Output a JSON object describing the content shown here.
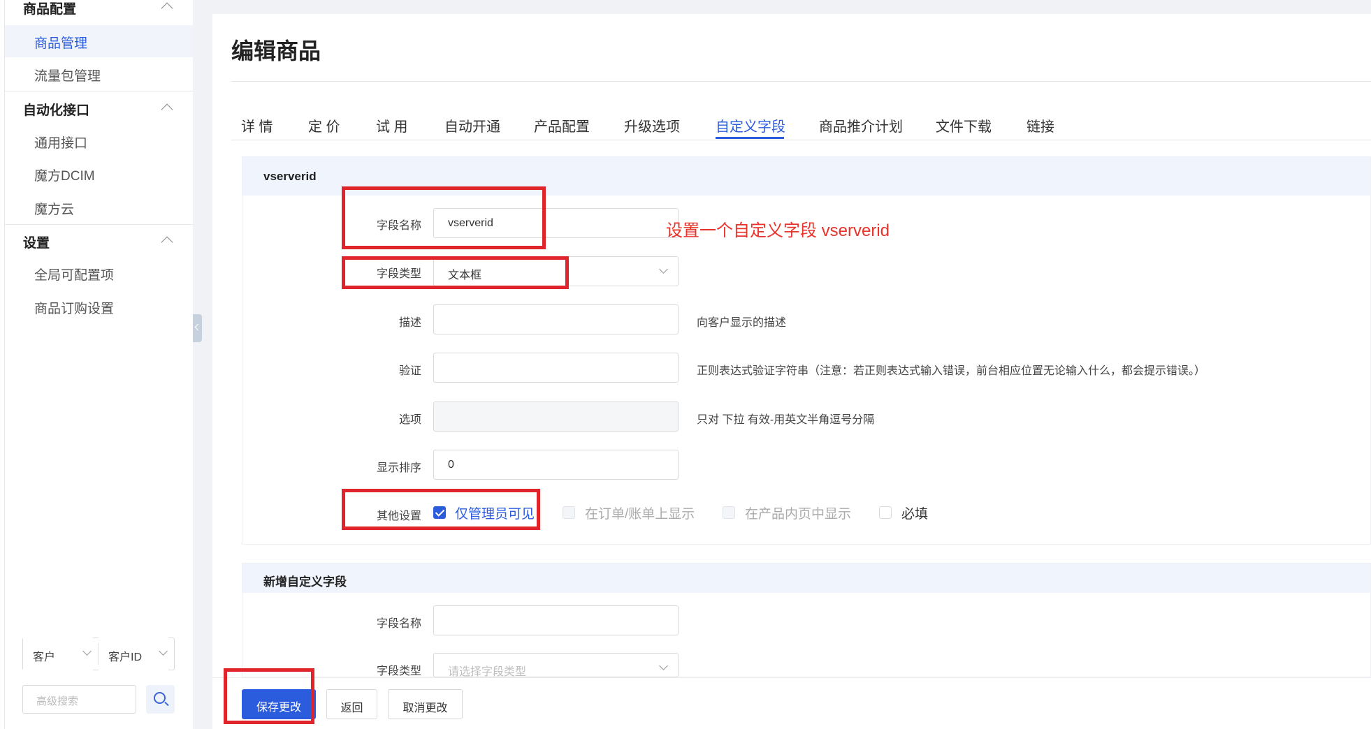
{
  "sidebar": {
    "groups": [
      {
        "label": "商品配置",
        "items": [
          {
            "label": "商品管理",
            "active": true
          },
          {
            "label": "流量包管理"
          }
        ]
      },
      {
        "label": "自动化接口",
        "items": [
          {
            "label": "通用接口"
          },
          {
            "label": "魔方DCIM"
          },
          {
            "label": "魔方云"
          }
        ]
      },
      {
        "label": "设置",
        "items": [
          {
            "label": "全局可配置项"
          },
          {
            "label": "商品订购设置"
          }
        ]
      }
    ],
    "search": {
      "type_value": "客户",
      "field_value": "客户ID",
      "advanced_placeholder": "高级搜索"
    }
  },
  "page": {
    "title": "编辑商品"
  },
  "tabs": [
    "详 情",
    "定 价",
    "试 用",
    "自动开通",
    "产品配置",
    "升级选项",
    "自定义字段",
    "商品推介计划",
    "文件下载",
    "链接"
  ],
  "active_tab": "自定义字段",
  "field_panel": {
    "title": "vserverid",
    "labels": {
      "name": "字段名称",
      "type": "字段类型",
      "desc": "描述",
      "validate": "验证",
      "options": "选项",
      "order": "显示排序",
      "other": "其他设置"
    },
    "values": {
      "name": "vserverid",
      "type": "文本框",
      "desc": "",
      "validate": "",
      "options": "",
      "order": "0"
    },
    "hints": {
      "desc": "向客户显示的描述",
      "validate": "正则表达式验证字符串（注意：若正则表达式输入错误，前台相应位置无论输入什么，都会提示错误。）",
      "options": "只对 下拉 有效-用英文半角逗号分隔"
    },
    "checkboxes": [
      {
        "label": "仅管理员可见",
        "checked": true
      },
      {
        "label": "在订单/账单上显示",
        "checked": false
      },
      {
        "label": "在产品内页中显示",
        "checked": false
      },
      {
        "label": "必填",
        "checked": false
      }
    ],
    "annotation": "设置一个自定义字段 vserverid"
  },
  "new_panel": {
    "title": "新增自定义字段",
    "labels": {
      "name": "字段名称",
      "type": "字段类型"
    },
    "type_placeholder": "请选择字段类型"
  },
  "footer": {
    "save": "保存更改",
    "back": "返回",
    "cancel": "取消更改"
  },
  "colors": {
    "accent": "#2b5cde",
    "annotation_red": "#e0242b"
  }
}
